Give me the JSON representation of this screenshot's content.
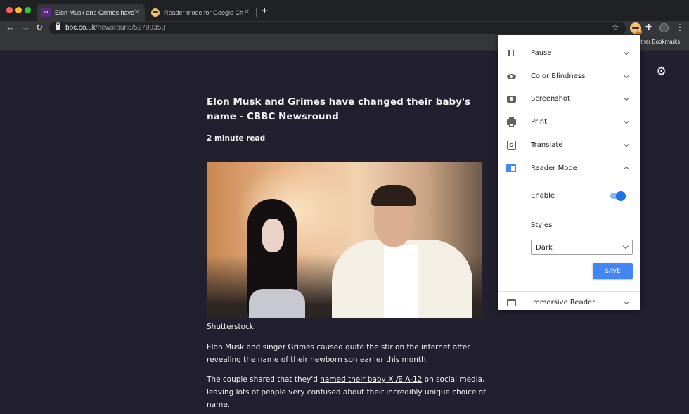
{
  "browser": {
    "tabs": [
      {
        "title": "Elon Musk and Grimes have changed their baby's name - CBBC Newsround",
        "favicon": "nr",
        "active": true
      },
      {
        "title": "Reader mode for Google Chrome",
        "active": false
      }
    ],
    "url_host": "bbc.co.uk",
    "url_path": "/newsround/52798358",
    "ext_badge": "On",
    "other_bookmarks": "Other Bookmarks"
  },
  "article": {
    "headline": "Elon Musk and Grimes have changed their baby's name - CBBC Newsround",
    "read_time": "2 minute read",
    "caption": "Shutterstock",
    "para1": "Elon Musk and singer Grimes caused quite the stir on the internet after revealing the name of their newborn son earlier this month.",
    "para2_before": "The couple shared that they'd ",
    "para2_link": "named their baby X Æ A-12",
    "para2_after": " on social media, leaving lots of people very confused about their incredibly unique choice of name."
  },
  "popup": {
    "items": {
      "pause": "Pause",
      "color_blindness": "Color Blindness",
      "screenshot": "Screenshot",
      "print": "Print",
      "translate": "Translate",
      "reader_mode": "Reader Mode",
      "immersive_reader": "Immersive Reader"
    },
    "reader": {
      "enable_label": "Enable",
      "enabled": true,
      "styles_label": "Styles",
      "style_value": "Dark",
      "save_label": "SAVE"
    }
  },
  "colors": {
    "page_bg": "#22202f",
    "accent": "#4285f4",
    "toggle_on": "#1a73e8"
  }
}
